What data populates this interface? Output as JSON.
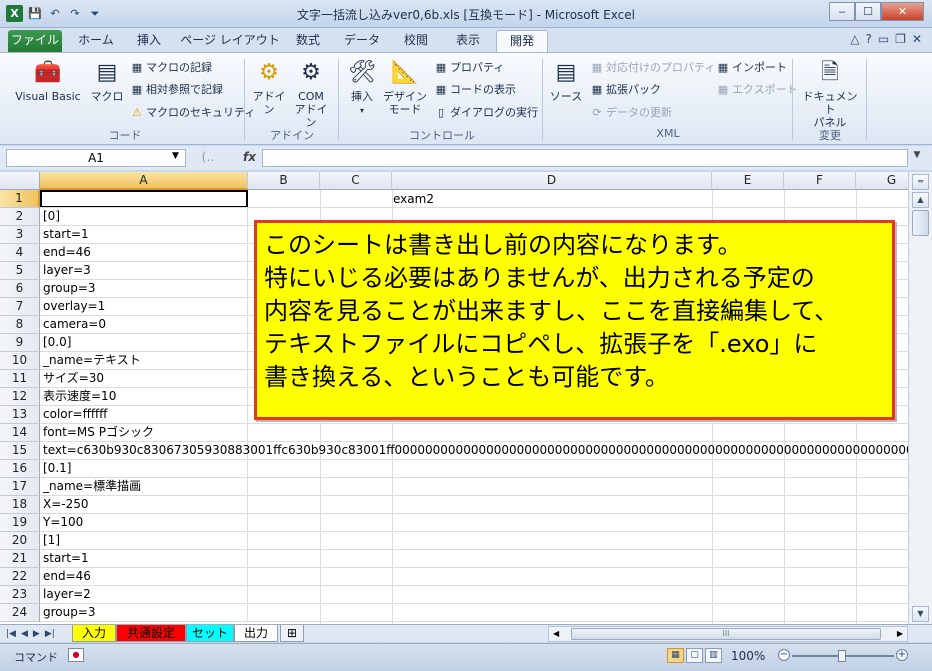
{
  "window": {
    "title": "文字一括流し込みver0,6b.xls  [互換モード] - Microsoft Excel",
    "btn_min": "‒",
    "btn_max": "☐",
    "btn_close": "✕"
  },
  "qat": {
    "app_icon": "X",
    "save_icon": "💾",
    "undo_icon": "↶",
    "redo_icon": "↷",
    "customize_icon": "⏷"
  },
  "tabs": [
    "ファイル",
    "ホーム",
    "挿入",
    "ページ レイアウト",
    "数式",
    "データ",
    "校閲",
    "表示",
    "開発"
  ],
  "active_tab": "開発",
  "tab_right_icons": {
    "collapse": "△",
    "help": "?",
    "min": "▭",
    "restore": "❐",
    "close": "✕"
  },
  "ribbon": {
    "code": {
      "label": "コード",
      "visual_basic": "Visual Basic",
      "macro": "マクロ",
      "record": "マクロの記録",
      "relative": "相対参照で記録",
      "security": "マクロのセキュリティ"
    },
    "addin": {
      "label": "アドイン",
      "addin": "アドイン",
      "com_addin_1": "COM",
      "com_addin_2": "アドイン"
    },
    "control": {
      "label": "コントロール",
      "insert": "挿入",
      "design_1": "デザイン",
      "design_2": "モード",
      "properties": "プロパティ",
      "view_code": "コードの表示",
      "dialog": "ダイアログの実行"
    },
    "xml": {
      "label": "XML",
      "source": "ソース",
      "map_props": "対応付けのプロパティ",
      "ext_pack": "拡張パック",
      "refresh": "データの更新",
      "import": "インポート",
      "export": "エクスポート"
    },
    "modify": {
      "label": "変更",
      "doc_panel_1": "ドキュメント",
      "doc_panel_2": "パネル"
    }
  },
  "formula_bar": {
    "name_box": "A1",
    "fx": "fx",
    "value": ""
  },
  "columns": [
    "A",
    "B",
    "C",
    "D",
    "E",
    "F",
    "G"
  ],
  "rows": [
    {
      "n": "1",
      "a": "",
      "d": "exam2"
    },
    {
      "n": "2",
      "a": "[0]"
    },
    {
      "n": "3",
      "a": "start=1"
    },
    {
      "n": "4",
      "a": "end=46"
    },
    {
      "n": "5",
      "a": "layer=3"
    },
    {
      "n": "6",
      "a": "group=3"
    },
    {
      "n": "7",
      "a": "overlay=1"
    },
    {
      "n": "8",
      "a": "camera=0"
    },
    {
      "n": "9",
      "a": "[0.0]"
    },
    {
      "n": "10",
      "a": "_name=テキスト"
    },
    {
      "n": "11",
      "a": "サイズ=30"
    },
    {
      "n": "12",
      "a": "表示速度=10"
    },
    {
      "n": "13",
      "a": "color=ffffff"
    },
    {
      "n": "14",
      "a": "font=MS Pゴシック"
    },
    {
      "n": "15",
      "a": "text=c630b930c830673059308830​01ffc630b930c83001ff00000000000000000000000000000000000000000000000000000000000000000000000000"
    },
    {
      "n": "16",
      "a": "[0.1]"
    },
    {
      "n": "17",
      "a": "_name=標準描画"
    },
    {
      "n": "18",
      "a": "X=-250"
    },
    {
      "n": "19",
      "a": "Y=100"
    },
    {
      "n": "20",
      "a": "[1]"
    },
    {
      "n": "21",
      "a": "start=1"
    },
    {
      "n": "22",
      "a": "end=46"
    },
    {
      "n": "23",
      "a": "layer=2"
    },
    {
      "n": "24",
      "a": "group=3"
    }
  ],
  "note": [
    "このシートは書き出し前の内容になります。",
    "特にいじる必要はありませんが、出力される予定の",
    "内容を見ることが出来ますし、ここを直接編集して、",
    "テキストファイルにコピペし、拡張子を「.exo」に",
    "書き換える、ということも可能です。"
  ],
  "sheets": [
    {
      "name": "入力",
      "color": "#ffff00"
    },
    {
      "name": "共通設定",
      "color": "#ff0000"
    },
    {
      "name": "セット",
      "color": "#00ffff"
    },
    {
      "name": "出力",
      "color": "#ffffff"
    }
  ],
  "status": {
    "mode": "コマンド",
    "zoom": "100%",
    "zoom_minus": "−",
    "zoom_plus": "+"
  }
}
